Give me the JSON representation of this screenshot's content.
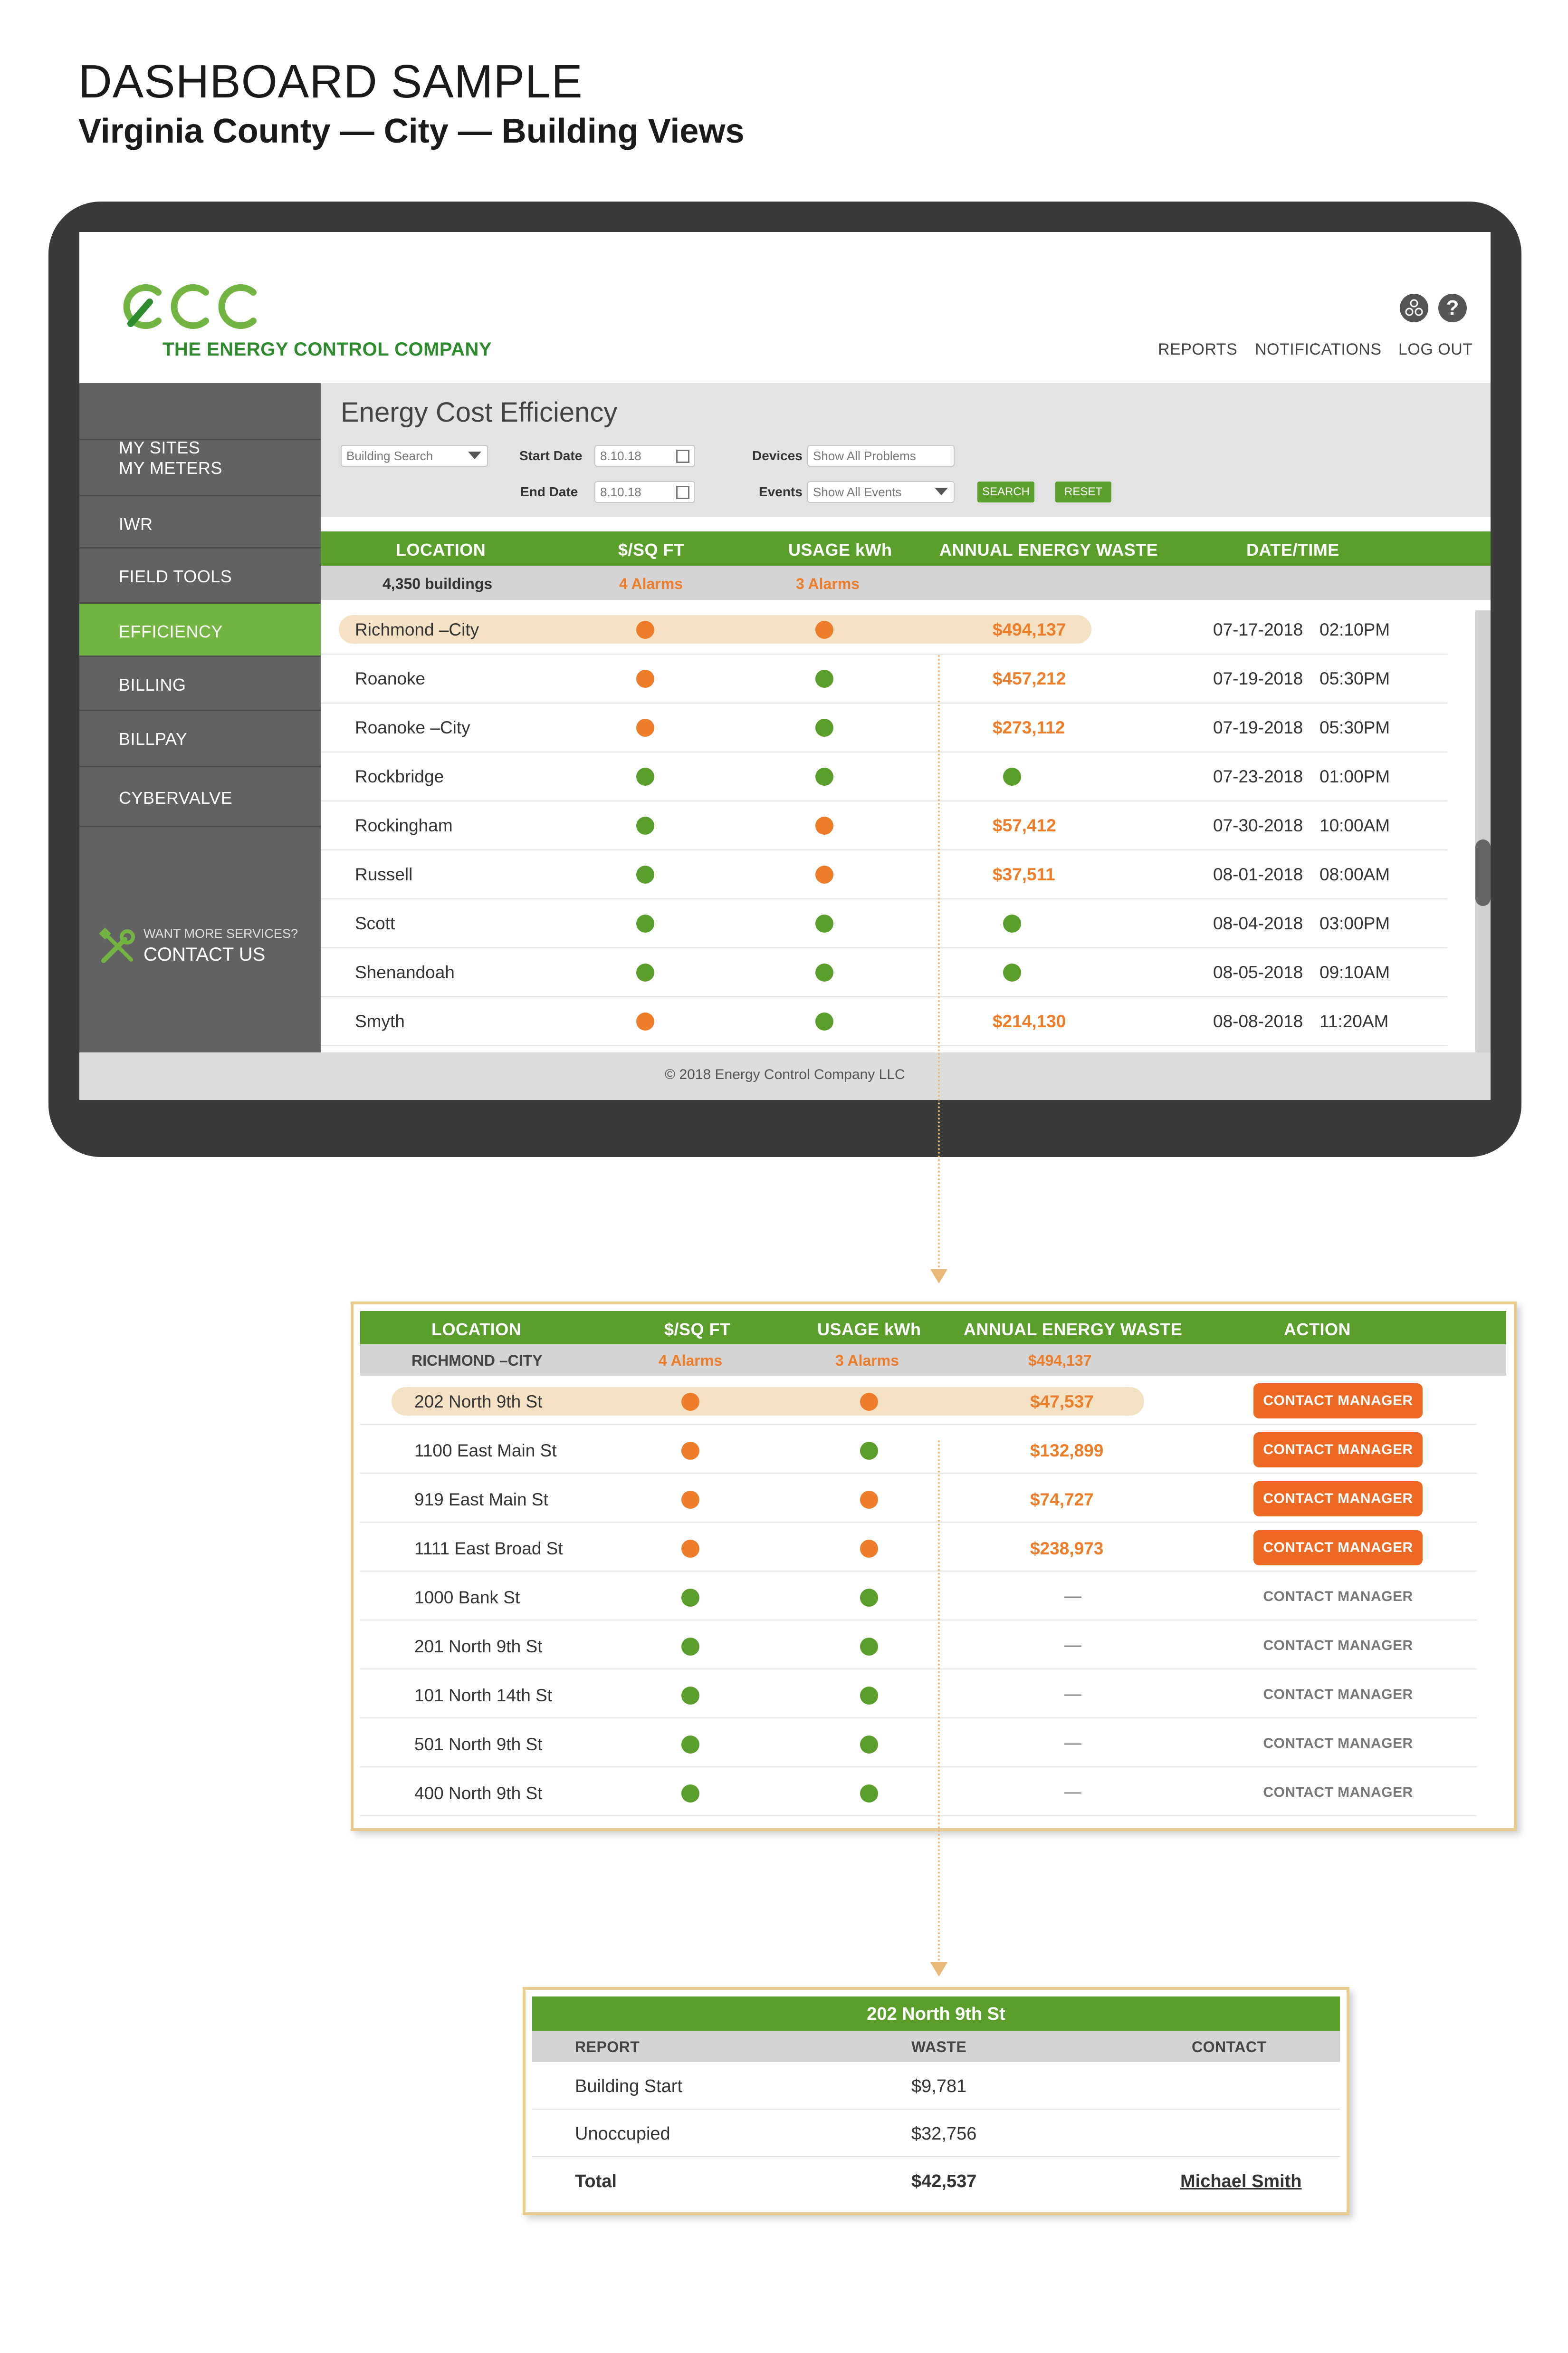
{
  "heading": {
    "title": "DASHBOARD SAMPLE",
    "subtitle": "Virginia County — City — Building Views"
  },
  "colors": {
    "brand_green": "#5a9e2c",
    "accent_orange": "#ee7d2a",
    "highlight": "#f5e2c4",
    "panel_border": "#eacb8c"
  },
  "app": {
    "logo_text": "THE ENERGY CONTROL COMPANY",
    "top_icons": [
      "network-icon",
      "help-icon"
    ],
    "help_glyph": "?",
    "top_nav": [
      "REPORTS",
      "NOTIFICATIONS",
      "LOG OUT"
    ],
    "sidebar": {
      "items": [
        "MY SITES",
        "MY METERS",
        "IWR",
        "FIELD TOOLS",
        "EFFICIENCY",
        "BILLING",
        "BILLPAY",
        "CYBERVALVE"
      ],
      "active": "EFFICIENCY",
      "contact_small": "WANT MORE SERVICES?",
      "contact_big": "CONTACT US"
    },
    "filters": {
      "title": "Energy Cost Efficiency",
      "building_search": "Building Search",
      "start_date_label": "Start Date",
      "start_date": "8.10.18",
      "end_date_label": "End Date",
      "end_date": "8.10.18",
      "devices_label": "Devices",
      "devices_value": "Show All Problems",
      "events_label": "Events",
      "events_value": "Show All Events",
      "search_btn": "SEARCH",
      "reset_btn": "RESET"
    },
    "table": {
      "headers": [
        "LOCATION",
        "$/SQ FT",
        "USAGE kWh",
        "ANNUAL ENERGY WASTE",
        "DATE/TIME"
      ],
      "summary": {
        "location": "4,350 buildings",
        "sqft": "4 Alarms",
        "usage": "3 Alarms"
      },
      "rows": [
        {
          "location": "Richmond –City",
          "sqft": "orange",
          "usage": "orange",
          "waste": "$494,137",
          "date": "07-17-2018",
          "time": "02:10PM"
        },
        {
          "location": "Roanoke",
          "sqft": "orange",
          "usage": "green",
          "waste": "$457,212",
          "date": "07-19-2018",
          "time": "05:30PM"
        },
        {
          "location": "Roanoke –City",
          "sqft": "orange",
          "usage": "green",
          "waste": "$273,112",
          "date": "07-19-2018",
          "time": "05:30PM"
        },
        {
          "location": "Rockbridge",
          "sqft": "green",
          "usage": "green",
          "waste": "",
          "date": "07-23-2018",
          "time": "01:00PM"
        },
        {
          "location": "Rockingham",
          "sqft": "green",
          "usage": "orange",
          "waste": "$57,412",
          "date": "07-30-2018",
          "time": "10:00AM"
        },
        {
          "location": "Russell",
          "sqft": "green",
          "usage": "orange",
          "waste": "$37,511",
          "date": "08-01-2018",
          "time": "08:00AM"
        },
        {
          "location": "Scott",
          "sqft": "green",
          "usage": "green",
          "waste": "",
          "date": "08-04-2018",
          "time": "03:00PM"
        },
        {
          "location": "Shenandoah",
          "sqft": "green",
          "usage": "green",
          "waste": "",
          "date": "08-05-2018",
          "time": "09:10AM"
        },
        {
          "location": "Smyth",
          "sqft": "orange",
          "usage": "green",
          "waste": "$214,130",
          "date": "08-08-2018",
          "time": "11:20AM"
        }
      ]
    },
    "footer": "© 2018 Energy Control Company LLC"
  },
  "city_panel": {
    "headers": [
      "LOCATION",
      "$/SQ FT",
      "USAGE kWh",
      "ANNUAL ENERGY WASTE",
      "ACTION"
    ],
    "summary": {
      "location": "RICHMOND –CITY",
      "sqft": "4 Alarms",
      "usage": "3 Alarms",
      "waste": "$494,137"
    },
    "action_label": "CONTACT MANAGER",
    "rows": [
      {
        "location": "202 North 9th St",
        "sqft": "orange",
        "usage": "orange",
        "waste": "$47,537"
      },
      {
        "location": "1100 East Main St",
        "sqft": "orange",
        "usage": "green",
        "waste": "$132,899"
      },
      {
        "location": "919 East Main St",
        "sqft": "orange",
        "usage": "orange",
        "waste": "$74,727"
      },
      {
        "location": "1111 East Broad St",
        "sqft": "orange",
        "usage": "orange",
        "waste": "$238,973"
      },
      {
        "location": "1000 Bank St",
        "sqft": "green",
        "usage": "green",
        "waste": "—"
      },
      {
        "location": "201 North 9th St",
        "sqft": "green",
        "usage": "green",
        "waste": "—"
      },
      {
        "location": "101 North 14th St",
        "sqft": "green",
        "usage": "green",
        "waste": "—"
      },
      {
        "location": "501 North 9th St",
        "sqft": "green",
        "usage": "green",
        "waste": "—"
      },
      {
        "location": "400 North 9th St",
        "sqft": "green",
        "usage": "green",
        "waste": "—"
      }
    ]
  },
  "building_panel": {
    "title": "202 North 9th St",
    "headers": [
      "REPORT",
      "WASTE",
      "CONTACT"
    ],
    "rows": [
      {
        "report": "Building Start",
        "waste": "$9,781",
        "contact": ""
      },
      {
        "report": "Unoccupied",
        "waste": "$32,756",
        "contact": ""
      },
      {
        "report": "Total",
        "waste": "$42,537",
        "contact": "Michael Smith"
      }
    ]
  }
}
